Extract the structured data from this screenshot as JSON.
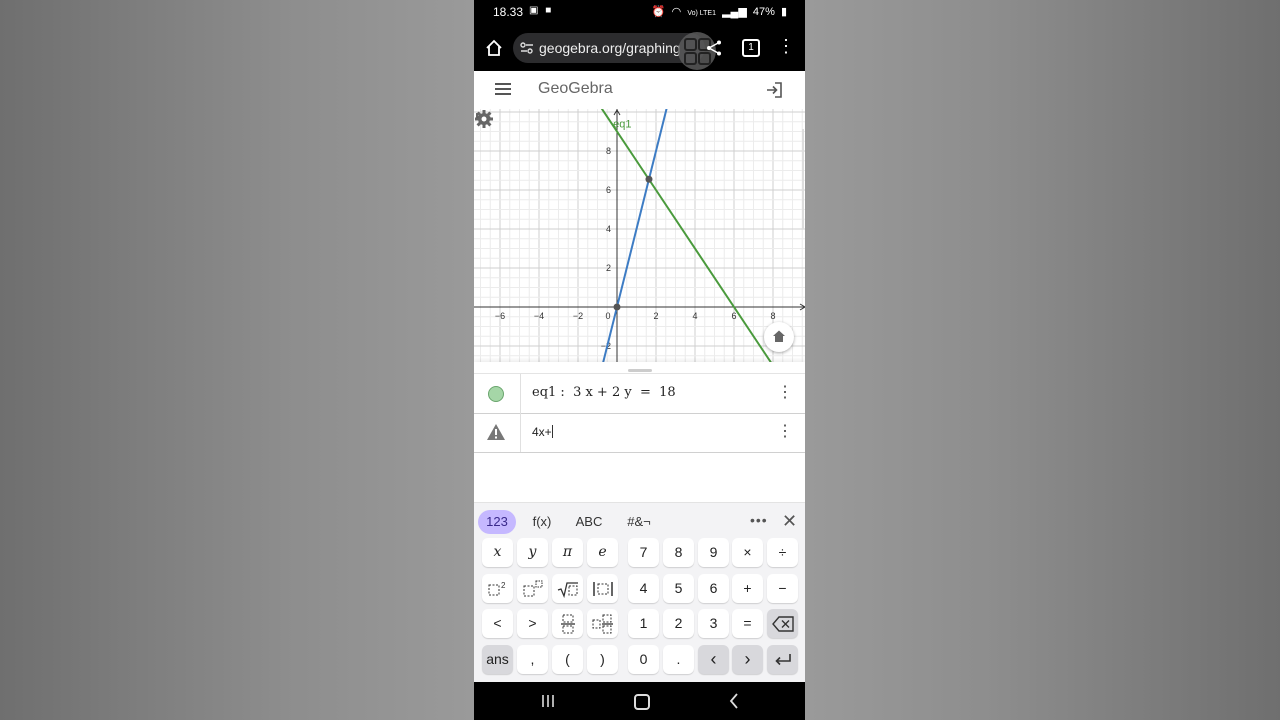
{
  "status": {
    "time": "18.33",
    "battery": "47%",
    "network": "Vo) LTE1"
  },
  "browser": {
    "url": "geogebra.org/graphing",
    "tab_count": "1"
  },
  "app": {
    "logo": "GeoGebra"
  },
  "graph": {
    "x_ticks": [
      "−6",
      "−4",
      "−2",
      "0",
      "2",
      "4",
      "6",
      "8"
    ],
    "y_ticks": [
      "8",
      "6",
      "4",
      "2",
      "−2"
    ],
    "curve_label": "eq1",
    "colors": {
      "line1": "#3d7cc4",
      "line2": "#4a9a3c",
      "point": "#555555"
    },
    "lines": {
      "blue": {
        "slope": 4,
        "intercept": 0
      },
      "green": {
        "equation": "3x + 2y = 18"
      }
    },
    "points": [
      {
        "x": 0,
        "y": 0
      },
      {
        "x": 1.64,
        "y": 6.55
      }
    ]
  },
  "algebra": {
    "row1": {
      "label": "eq1",
      "expression": "eq1 :  3 x + 2 y  =  18"
    },
    "row2": {
      "input": "4x+"
    }
  },
  "keyboard": {
    "tabs": [
      "123",
      "f(x)",
      "ABC",
      "#&¬"
    ],
    "keys": {
      "x": "x",
      "y": "y",
      "pi": "π",
      "e": "e",
      "n7": "7",
      "n8": "8",
      "n9": "9",
      "times": "×",
      "divide": "÷",
      "n4": "4",
      "n5": "5",
      "n6": "6",
      "plus": "+",
      "minus": "−",
      "lt": "<",
      "gt": ">",
      "n1": "1",
      "n2": "2",
      "n3": "3",
      "equals": "=",
      "ans": "ans",
      "comma": ",",
      "lparen": "(",
      "rparen": ")",
      "n0": "0",
      "dot": ".",
      "left": "‹",
      "right": "›"
    }
  }
}
